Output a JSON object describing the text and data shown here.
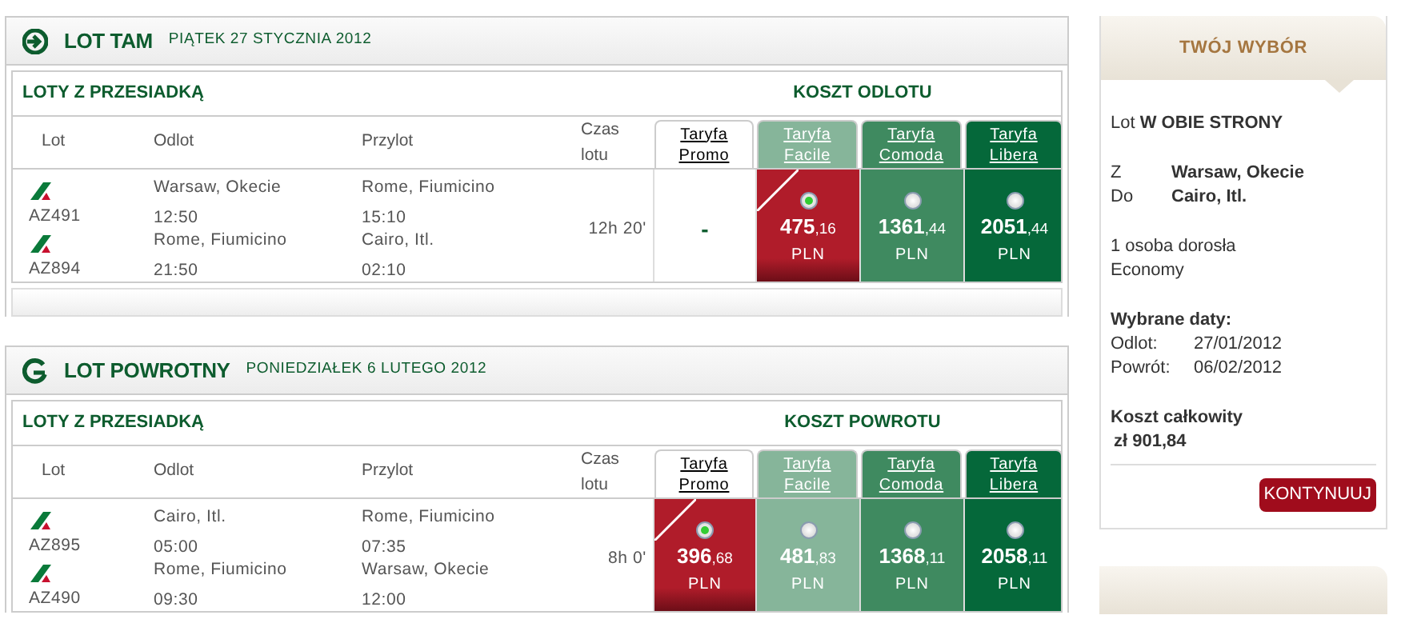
{
  "sections": [
    {
      "kind": "outbound",
      "title": "LOT TAM",
      "date": "PIĄTEK 27 STYCZNIA 2012",
      "subtitle": "LOTY Z PRZESIADKĄ",
      "cost_label": "KOSZT ODLOTU",
      "footer_bar": true,
      "columns": [
        "Lot",
        "Odlot",
        "Przylot",
        "Czas lotu"
      ],
      "fares": [
        {
          "label": "Taryfa Promo",
          "color": "#ffffff"
        },
        {
          "label": "Taryfa Facile",
          "color": "#86b59a"
        },
        {
          "label": "Taryfa Comoda",
          "color": "#3f8a60"
        },
        {
          "label": "Taryfa Libera",
          "color": "#05683a"
        }
      ],
      "legs": [
        {
          "flight": "AZ491",
          "from": "Warsaw, Okecie",
          "dep": "12:50",
          "to": "Rome, Fiumicino",
          "arr": "15:10"
        },
        {
          "flight": "AZ894",
          "from": "Rome, Fiumicino",
          "dep": "21:50",
          "to": "Cairo, Itl.",
          "arr": "02:10"
        }
      ],
      "duration": "12h 20'",
      "prices": [
        {
          "kind": "none",
          "text": "-"
        },
        {
          "kind": "price",
          "amount": "475",
          "decimals": ",16",
          "currency": "PLN",
          "selected": true
        },
        {
          "kind": "price",
          "amount": "1361",
          "decimals": ",44",
          "currency": "PLN",
          "selected": false
        },
        {
          "kind": "price",
          "amount": "2051",
          "decimals": ",44",
          "currency": "PLN",
          "selected": false
        }
      ]
    },
    {
      "kind": "return",
      "title": "LOT POWROTNY",
      "date": "PONIEDZIAŁEK 6 LUTEGO 2012",
      "subtitle": "LOTY Z PRZESIADKĄ",
      "cost_label": "KOSZT POWROTU",
      "footer_bar": false,
      "columns": [
        "Lot",
        "Odlot",
        "Przylot",
        "Czas lotu"
      ],
      "fares": [
        {
          "label": "Taryfa Promo",
          "color": "#ffffff"
        },
        {
          "label": "Taryfa Facile",
          "color": "#86b59a"
        },
        {
          "label": "Taryfa Comoda",
          "color": "#3f8a60"
        },
        {
          "label": "Taryfa Libera",
          "color": "#05683a"
        }
      ],
      "legs": [
        {
          "flight": "AZ895",
          "from": "Cairo, Itl.",
          "dep": "05:00",
          "to": "Rome, Fiumicino",
          "arr": "07:35"
        },
        {
          "flight": "AZ490",
          "from": "Rome, Fiumicino",
          "dep": "09:30",
          "to": "Warsaw, Okecie",
          "arr": "12:00"
        }
      ],
      "duration": "8h 0'",
      "prices": [
        {
          "kind": "price",
          "amount": "396",
          "decimals": ",68",
          "currency": "PLN",
          "selected": true
        },
        {
          "kind": "price",
          "amount": "481",
          "decimals": ",83",
          "currency": "PLN",
          "selected": false
        },
        {
          "kind": "price",
          "amount": "1368",
          "decimals": ",11",
          "currency": "PLN",
          "selected": false
        },
        {
          "kind": "price",
          "amount": "2058",
          "decimals": ",11",
          "currency": "PLN",
          "selected": false
        }
      ]
    }
  ],
  "summary": {
    "title": "TWÓJ WYBÓR",
    "trip": "Lot **W OBIE STRONY**",
    "route": [
      {
        "label": "Z",
        "value": "Warsaw, Okecie"
      },
      {
        "label": "Do",
        "value": "Cairo, Itl."
      }
    ],
    "passengers": "1 osoba dorosła",
    "cabin": "Economy",
    "dates_title": "Wybrane daty:",
    "dates": [
      {
        "label": "Odlot:",
        "value": "27/01/2012"
      },
      {
        "label": "Powrót:",
        "value": "06/02/2012"
      }
    ],
    "total_label": "Koszt całkowity",
    "total": "zł 901,84",
    "button": "KONTYNUUJ"
  },
  "next_panel": {
    "kind": "panel"
  }
}
